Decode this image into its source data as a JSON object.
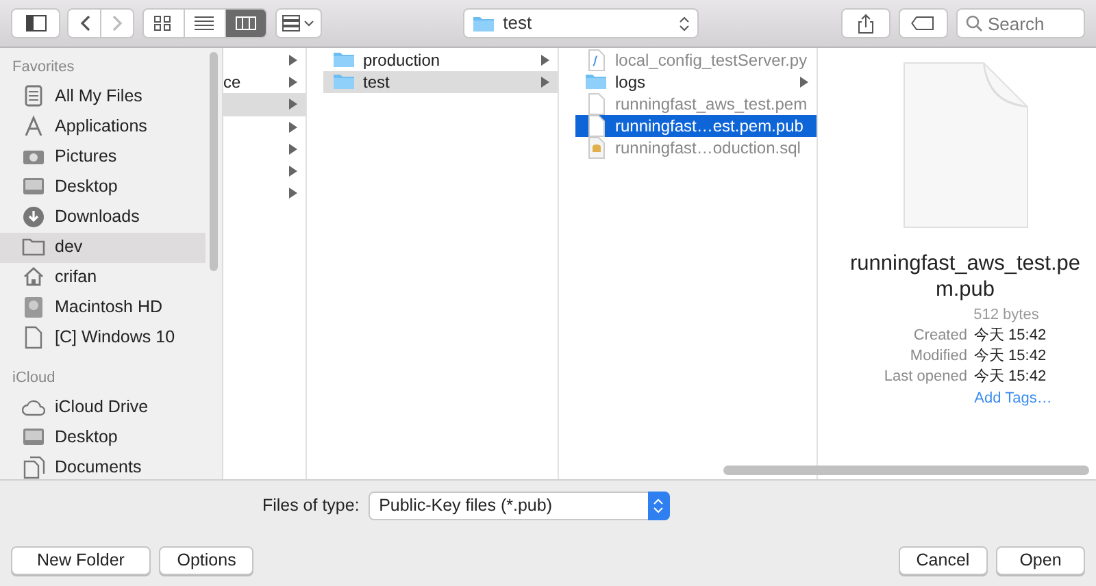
{
  "toolbar": {
    "views": [
      {
        "kind": "icons",
        "selected": false
      },
      {
        "kind": "list",
        "selected": false
      },
      {
        "kind": "columns",
        "selected": true
      }
    ],
    "back_disabled": false,
    "forward_disabled": true,
    "path": "test",
    "search": {
      "placeholder": "Search"
    }
  },
  "sidebar": {
    "sections": [
      {
        "title": "Favorites",
        "items": [
          {
            "label": "All My Files",
            "kind": "files",
            "selected": false
          },
          {
            "label": "Applications",
            "kind": "apps",
            "selected": false
          },
          {
            "label": "Pictures",
            "kind": "camera",
            "selected": false
          },
          {
            "label": "Desktop",
            "kind": "screen",
            "selected": false
          },
          {
            "label": "Downloads",
            "kind": "download",
            "selected": false
          },
          {
            "label": "dev",
            "kind": "folder",
            "selected": true
          },
          {
            "label": "crifan",
            "kind": "home",
            "selected": false
          },
          {
            "label": "Macintosh HD",
            "kind": "disk",
            "selected": false
          },
          {
            "label": "[C] Windows 10",
            "kind": "document",
            "selected": false
          }
        ]
      },
      {
        "title": "iCloud",
        "items": [
          {
            "label": "iCloud Drive",
            "kind": "cloud",
            "selected": false
          },
          {
            "label": "Desktop",
            "kind": "screen",
            "selected": false
          },
          {
            "label": "Documents",
            "kind": "documents",
            "selected": false
          }
        ]
      }
    ]
  },
  "columns": [
    {
      "items": [
        {
          "has_children": true,
          "selected": false
        },
        {
          "label": "ce",
          "has_children": true,
          "selected": false
        },
        {
          "has_children": true,
          "selected": true
        },
        {
          "has_children": true,
          "selected": false
        },
        {
          "has_children": true,
          "selected": false
        },
        {
          "has_children": true,
          "selected": false
        },
        {
          "has_children": true,
          "selected": false
        }
      ]
    },
    {
      "items": [
        {
          "label": "production",
          "kind": "folder",
          "has_children": true,
          "selected": false,
          "disabled": false
        },
        {
          "label": "test",
          "kind": "folder",
          "has_children": true,
          "selected": true,
          "disabled": false
        }
      ]
    },
    {
      "items": [
        {
          "label": "local_config_testServer.py",
          "kind": "script",
          "has_children": false,
          "selected": false,
          "disabled": true
        },
        {
          "label": "logs",
          "kind": "folder",
          "has_children": true,
          "selected": false,
          "disabled": false
        },
        {
          "label": "runningfast_aws_test.pem",
          "kind": "document",
          "has_children": false,
          "selected": false,
          "disabled": true
        },
        {
          "label": "runningfast…est.pem.pub",
          "kind": "document",
          "has_children": false,
          "selected": true,
          "disabled": false
        },
        {
          "label": "runningfast…oduction.sql",
          "kind": "database",
          "has_children": false,
          "selected": false,
          "disabled": true
        }
      ]
    }
  ],
  "preview": {
    "filename": "runningfast_aws_test.pem.pub",
    "size": "512 bytes",
    "details": [
      {
        "label": "Created",
        "value": "今天 15:42"
      },
      {
        "label": "Modified",
        "value": "今天 15:42"
      },
      {
        "label": "Last opened",
        "value": "今天 15:42"
      }
    ],
    "add_tags": "Add Tags…"
  },
  "filter": {
    "label": "Files of type:",
    "value": "Public-Key files (*.pub)"
  },
  "buttons_left": [
    "New Folder",
    "Options"
  ],
  "buttons_right": [
    {
      "label": "Cancel",
      "default": false
    },
    {
      "label": "Open",
      "default": false
    }
  ]
}
